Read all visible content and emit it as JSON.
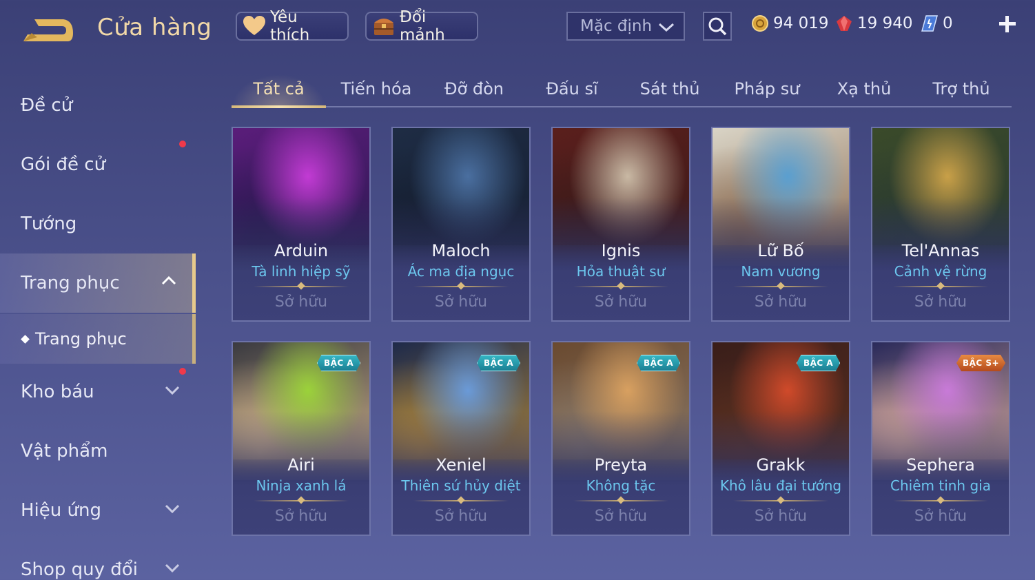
{
  "header": {
    "title": "Cửa hàng",
    "favorites_label": "Yêu thích",
    "exchange_label": "Đổi mảnh",
    "sort_label": "Mặc định",
    "currencies": [
      {
        "name": "gold-coin",
        "value": "94 019"
      },
      {
        "name": "ruby",
        "value": "19 940"
      },
      {
        "name": "voucher",
        "value": "0"
      }
    ]
  },
  "sidebar": {
    "items": [
      {
        "label": "Đề cử"
      },
      {
        "label": "Gói đề cử"
      },
      {
        "label": "Tướng"
      },
      {
        "label": "Trang phục"
      },
      {
        "label": "Trang phục"
      },
      {
        "label": "Kho báu"
      },
      {
        "label": "Vật phẩm"
      },
      {
        "label": "Hiệu ứng"
      },
      {
        "label": "Shop quy đổi"
      }
    ]
  },
  "tabs": [
    "Tất cả",
    "Tiến hóa",
    "Đỡ đòn",
    "Đấu sĩ",
    "Sát thủ",
    "Pháp sư",
    "Xạ thủ",
    "Trợ thủ"
  ],
  "cards": [
    {
      "hero": "Arduin",
      "skin": "Tà linh hiệp sỹ",
      "status": "Sở hữu",
      "badge": "",
      "colors": [
        "#5a1d7a",
        "#c23bd4",
        "#2a1850"
      ]
    },
    {
      "hero": "Maloch",
      "skin": "Ác ma địa ngục",
      "status": "Sở hữu",
      "badge": "",
      "colors": [
        "#1e2c44",
        "#4a6fa0",
        "#151e30"
      ]
    },
    {
      "hero": "Ignis",
      "skin": "Hỏa thuật sư",
      "status": "Sở hữu",
      "badge": "",
      "colors": [
        "#5a1f1c",
        "#c9b9a4",
        "#3a1a1a"
      ]
    },
    {
      "hero": "Lữ Bố",
      "skin": "Nam vương",
      "status": "Sở hữu",
      "badge": "",
      "colors": [
        "#d9d4c6",
        "#5a9fd0",
        "#8a6a50"
      ]
    },
    {
      "hero": "Tel'Annas",
      "skin": "Cảnh vệ rừng",
      "status": "Sở hữu",
      "badge": "",
      "colors": [
        "#3a4a2a",
        "#c9a048",
        "#2a3a30"
      ]
    },
    {
      "hero": "Airi",
      "skin": "Ninja xanh lá",
      "status": "Sở hữu",
      "badge": "BẬC A",
      "colors": [
        "#3a3a40",
        "#9bd23a",
        "#d2b48a"
      ]
    },
    {
      "hero": "Xeniel",
      "skin": "Thiên sứ hủy diệt",
      "status": "Sở hữu",
      "badge": "BẬC A",
      "colors": [
        "#1e2a4a",
        "#6a9ad8",
        "#b48a3a"
      ]
    },
    {
      "hero": "Preyta",
      "skin": "Không tặc",
      "status": "Sở hữu",
      "badge": "BẬC A",
      "colors": [
        "#6a4a30",
        "#d8a060",
        "#8a7a6a"
      ]
    },
    {
      "hero": "Grakk",
      "skin": "Khô lâu đại tướng",
      "status": "Sở hữu",
      "badge": "BẬC A",
      "colors": [
        "#3a1e1a",
        "#d04a2a",
        "#5a3020"
      ]
    },
    {
      "hero": "Sephera",
      "skin": "Chiêm tinh gia",
      "status": "Sở hữu",
      "badge": "BẬC S+",
      "colors": [
        "#2a2a5a",
        "#c87ad8",
        "#e0b0a0"
      ]
    }
  ],
  "accent_color": "#e6c98c",
  "skin_name_color": "#6cc7ee"
}
